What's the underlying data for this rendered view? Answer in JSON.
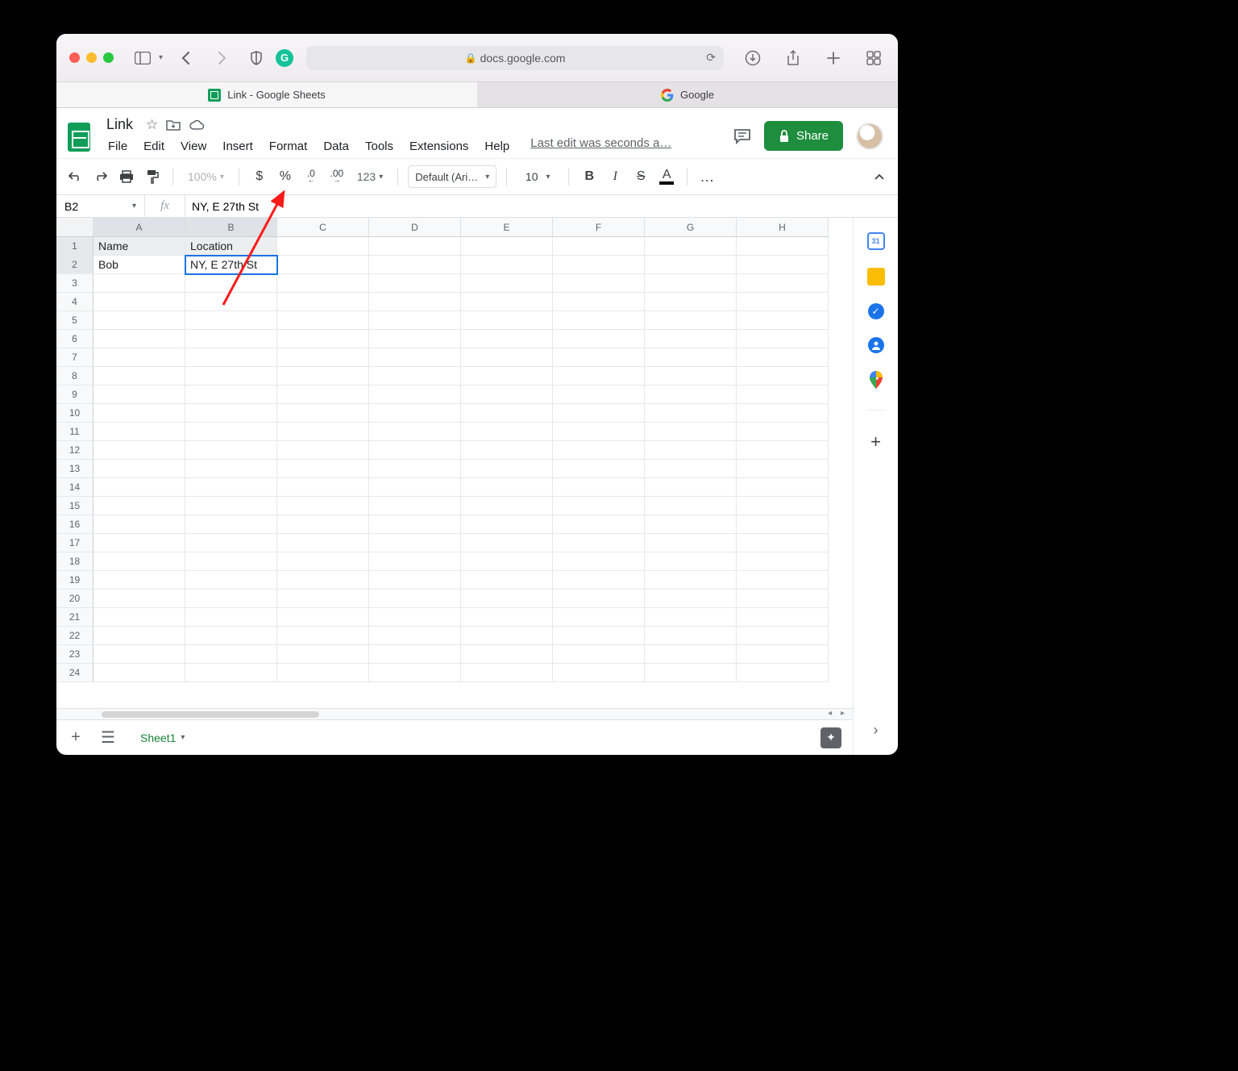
{
  "browser": {
    "url_host": "docs.google.com",
    "tabs": [
      {
        "title": "Link - Google Sheets",
        "active": true
      },
      {
        "title": "Google",
        "active": false
      }
    ]
  },
  "sheets": {
    "doc_title": "Link",
    "menus": [
      "File",
      "Edit",
      "View",
      "Insert",
      "Format",
      "Data",
      "Tools",
      "Extensions",
      "Help"
    ],
    "last_edit": "Last edit was seconds a…",
    "share_label": "Share",
    "toolbar": {
      "zoom": "100%",
      "num_format": "123",
      "font": "Default (Ari…",
      "font_size": "10",
      "currency": "$",
      "percent": "%",
      "dec_dec": ".0",
      "dec_inc": ".00",
      "bold": "B",
      "italic": "I",
      "strike": "S",
      "text_color_letter": "A",
      "more": "…"
    },
    "name_box": "B2",
    "formula": "NY, E 27th St",
    "columns": [
      "A",
      "B",
      "C",
      "D",
      "E",
      "F",
      "G",
      "H"
    ],
    "row_count": 24,
    "active_cell": {
      "row": 2,
      "col": 2
    },
    "cells": {
      "r1": {
        "A": "Name",
        "B": "Location"
      },
      "r2": {
        "A": "Bob",
        "B": "NY, E 27th St"
      }
    },
    "sheet_tab": "Sheet1"
  }
}
